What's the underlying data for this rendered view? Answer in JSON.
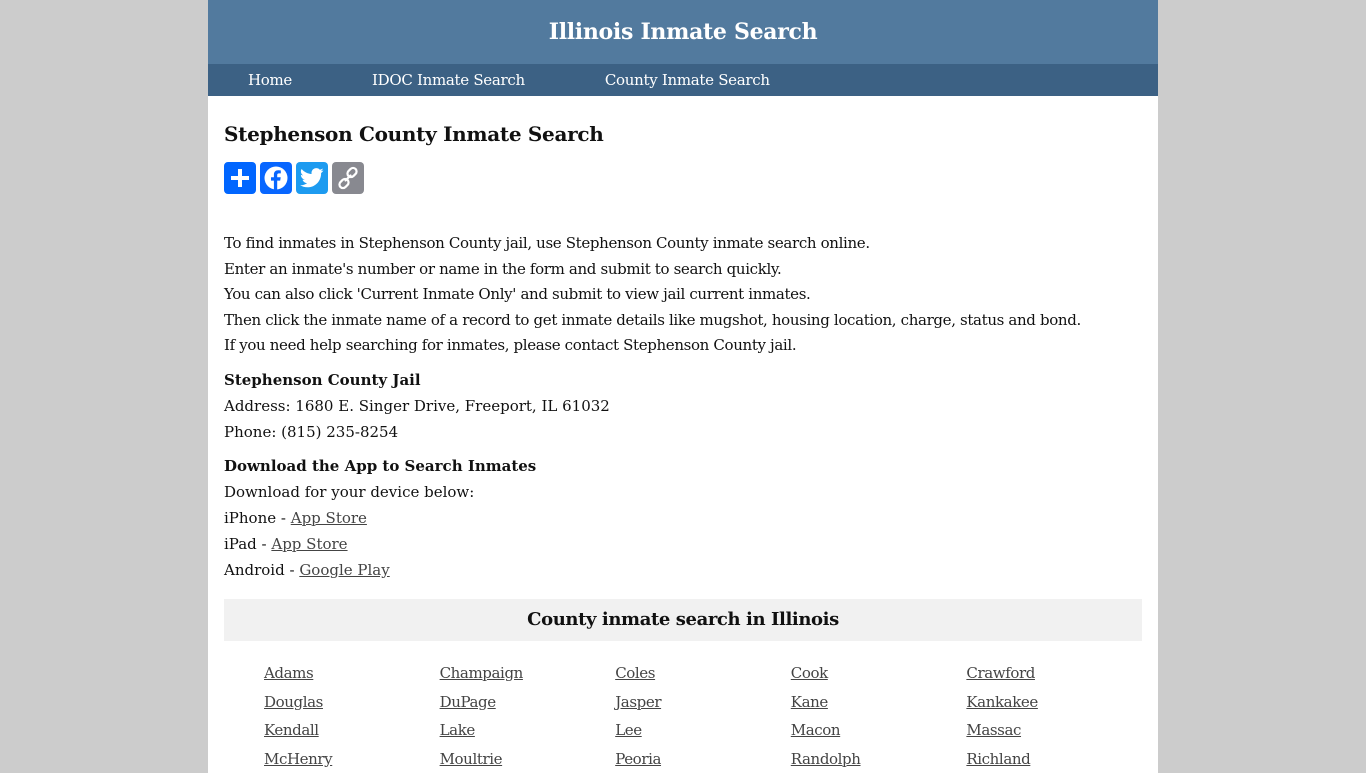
{
  "header": {
    "site_title": "Illinois Inmate Search"
  },
  "nav": {
    "items": [
      {
        "label": "Home"
      },
      {
        "label": "IDOC Inmate Search"
      },
      {
        "label": "County Inmate Search"
      }
    ]
  },
  "main": {
    "title": "Stephenson County Inmate Search",
    "share_buttons": [
      {
        "icon": "plus-icon",
        "label": "Share",
        "color": "#0166ff"
      },
      {
        "icon": "facebook-icon",
        "label": "Facebook",
        "color": "#0866ff"
      },
      {
        "icon": "twitter-icon",
        "label": "Twitter",
        "color": "#1d9bf0"
      },
      {
        "icon": "link-icon",
        "label": "Copy Link",
        "color": "#888990"
      }
    ],
    "intro": [
      "To find inmates in Stephenson County jail, use Stephenson County inmate search online.",
      "Enter an inmate's number or name in the form and submit to search quickly.",
      "You can also click 'Current Inmate Only' and submit to view jail current inmates.",
      "Then click the inmate name of a record to get inmate details like mugshot, housing location, charge, status and bond.",
      "If you need help searching for inmates, please contact Stephenson County jail."
    ],
    "jail": {
      "heading": "Stephenson County Jail",
      "address": "Address: 1680 E. Singer Drive, Freeport, IL 61032",
      "phone": "Phone: (815) 235-8254"
    },
    "app": {
      "heading": "Download the App to Search Inmates",
      "subtitle": "Download for your device below:",
      "links": [
        {
          "device": "iPhone - ",
          "store": "App Store"
        },
        {
          "device": "iPad - ",
          "store": "App Store"
        },
        {
          "device": "Android - ",
          "store": "Google Play"
        }
      ]
    },
    "counties": {
      "heading": "County inmate search in Illinois",
      "items": [
        "Adams",
        "Champaign",
        "Coles",
        "Cook",
        "Crawford",
        "Douglas",
        "DuPage",
        "Jasper",
        "Kane",
        "Kankakee",
        "Kendall",
        "Lake",
        "Lee",
        "Macon",
        "Massac",
        "McHenry",
        "Moultrie",
        "Peoria",
        "Randolph",
        "Richland"
      ]
    }
  }
}
